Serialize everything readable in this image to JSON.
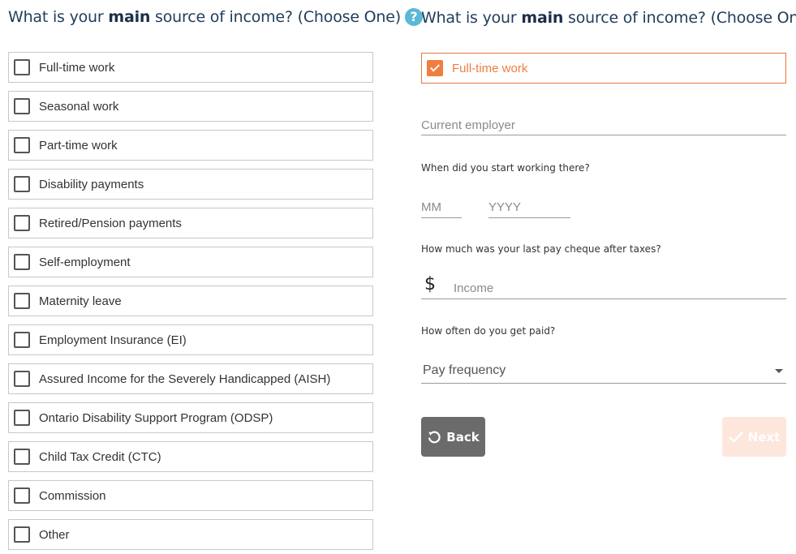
{
  "question": {
    "prefix": "What is your ",
    "emphasis": "main",
    "suffix": " source of income? (Choose One)",
    "help_glyph": "?"
  },
  "options": [
    {
      "label": "Full-time work"
    },
    {
      "label": "Seasonal work"
    },
    {
      "label": "Part-time work"
    },
    {
      "label": "Disability payments"
    },
    {
      "label": "Retired/Pension payments"
    },
    {
      "label": "Self-employment"
    },
    {
      "label": "Maternity leave"
    },
    {
      "label": "Employment Insurance (EI)"
    },
    {
      "label": "Assured Income for the Severely Handicapped (AISH)"
    },
    {
      "label": "Ontario Disability Support Program (ODSP)"
    },
    {
      "label": "Child Tax Credit (CTC)"
    },
    {
      "label": "Commission"
    },
    {
      "label": "Other"
    }
  ],
  "selected_option": {
    "label": "Full-time work",
    "checked": true
  },
  "employer": {
    "placeholder": "Current employer",
    "value": ""
  },
  "start_date": {
    "label": "When did you start working there?",
    "month_placeholder": "MM",
    "year_placeholder": "YYYY"
  },
  "pay": {
    "label": "How much was your last pay cheque after taxes?",
    "currency_symbol": "$",
    "placeholder": "Income"
  },
  "frequency": {
    "label": "How often do you get paid?",
    "selected": "Pay frequency"
  },
  "buttons": {
    "back": "Back",
    "next": "Next"
  },
  "colors": {
    "accent": "#ef7e3f",
    "title": "#1f3c5a",
    "help": "#5bb8d6",
    "back_button": "#6b6b6b",
    "next_button_disabled": "#fde6dc"
  },
  "icons": {
    "help": "help-circle-icon",
    "checkbox": "checkbox-icon",
    "back": "undo-arrow-icon",
    "next": "checkmark-icon",
    "dropdown": "caret-down-icon"
  }
}
